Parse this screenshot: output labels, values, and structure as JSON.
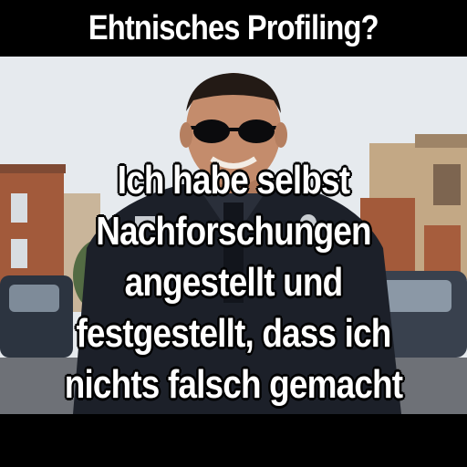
{
  "meme": {
    "top_text": "Ehtnisches Profiling?",
    "bottom_text": "Ich habe selbst Nachforschungen angestellt und festgestellt, dass ich nichts falsch gemacht habe"
  },
  "colors": {
    "bar": "#000000",
    "text": "#ffffff",
    "uniform": "#1c2029",
    "skin": "#c48c6c",
    "brick": "#a0583a",
    "sky": "#e9edf1"
  }
}
